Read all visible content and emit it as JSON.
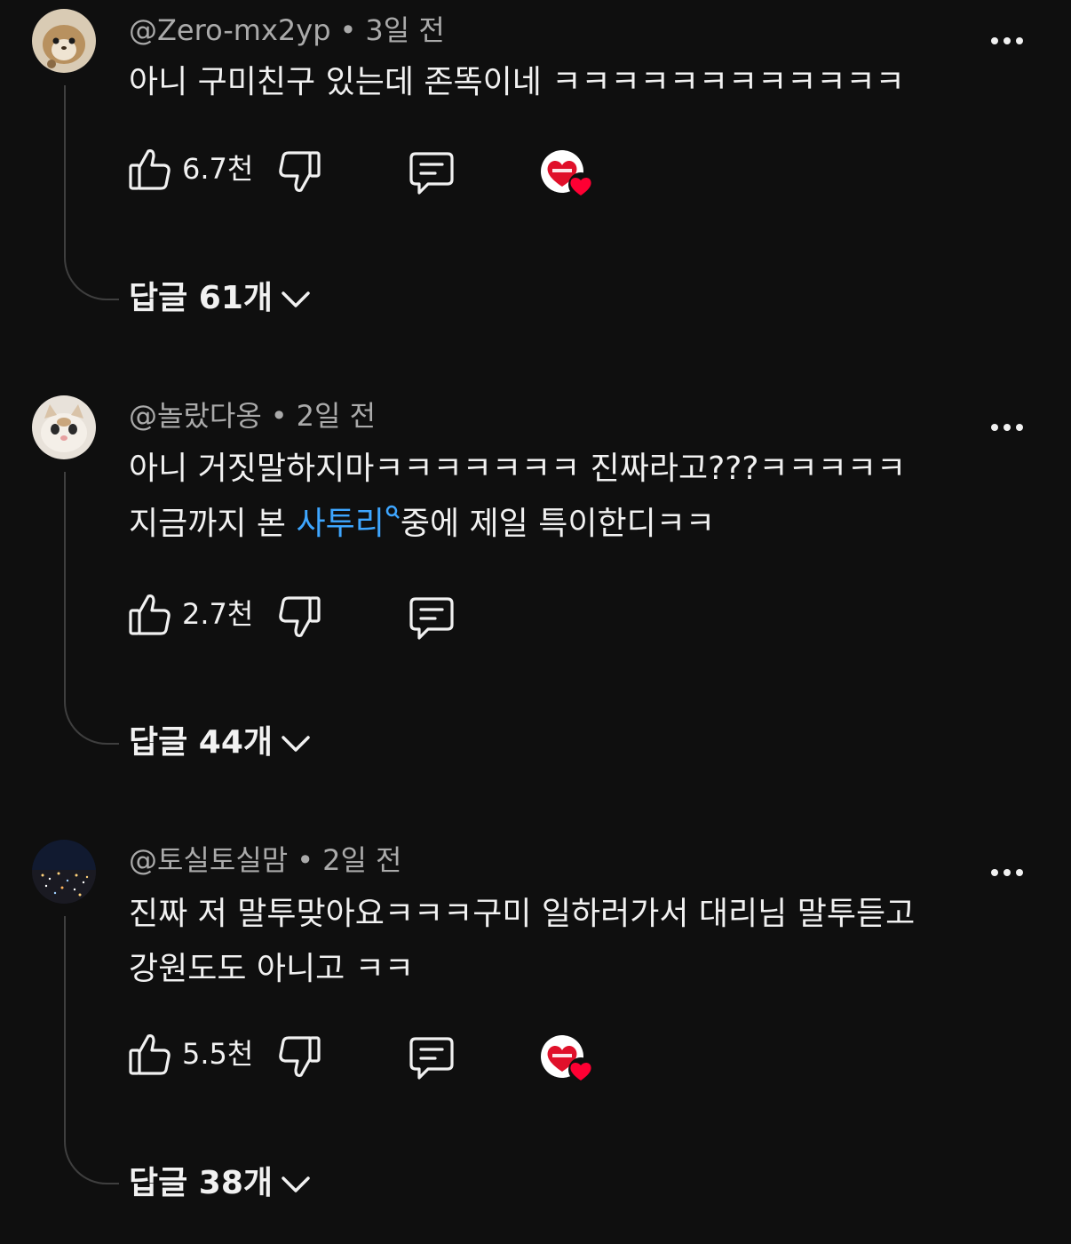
{
  "comments": [
    {
      "author": "@Zero-mx2yp",
      "time": "3일 전",
      "text": "아니 구미친구 있는데 존똑이네 ㅋㅋㅋㅋㅋㅋㅋㅋㅋㅋㅋㅋ",
      "likes": "6.7천",
      "creator_heart": true,
      "replies": "답글 61개"
    },
    {
      "author": "@놀랐다옹",
      "time": "2일 전",
      "text_line1": "아니 거짓말하지마ㅋㅋㅋㅋㅋㅋㅋ 진짜라고???ㅋㅋㅋㅋㅋ",
      "text_line2_pre": "지금까지 본 ",
      "text_link": "사투리",
      "text_line2_post": "중에 제일 특이한디ㅋㅋ",
      "likes": "2.7천",
      "creator_heart": false,
      "replies": "답글 44개"
    },
    {
      "author": "@토실토실맘",
      "time": "2일 전",
      "text_line1": "진짜 저 말투맞아요ㅋㅋㅋ구미 일하러가서 대리님 말투듣고",
      "text_line2": "강원도도 아니고 ㅋㅋ",
      "likes": "5.5천",
      "creator_heart": true,
      "replies": "답글 38개"
    }
  ],
  "separator": "•",
  "icons": {
    "like": "thumbs-up-icon",
    "dislike": "thumbs-down-icon",
    "reply": "comment-icon",
    "more": "more-dots-icon",
    "expand": "chevron-down-icon",
    "heart": "creator-heart-badge"
  },
  "colors": {
    "background": "#0f0f0f",
    "text": "#f1f1f1",
    "secondary": "#aaaaaa",
    "link": "#3ea6ff",
    "heart": "#ff0033"
  }
}
